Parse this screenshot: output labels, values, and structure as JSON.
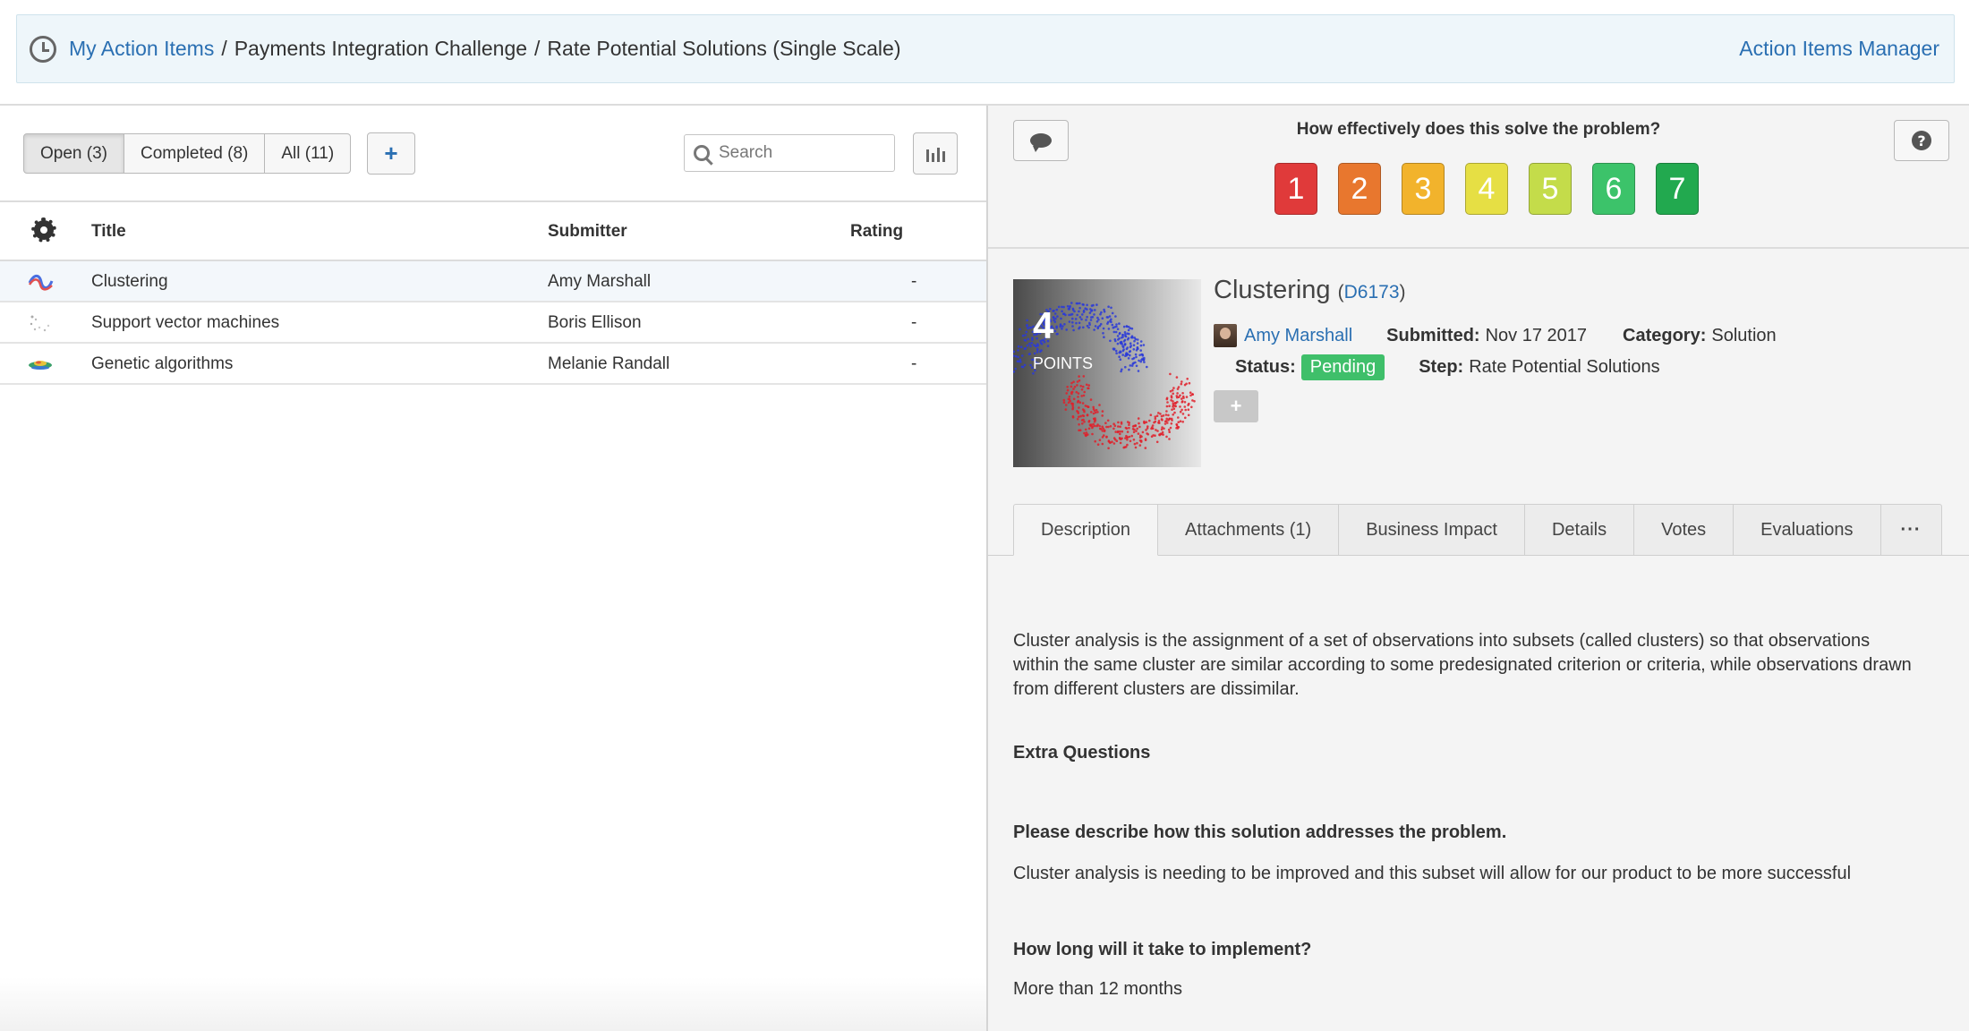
{
  "breadcrumb": {
    "root": "My Action Items",
    "sep": "/",
    "challenge": "Payments Integration Challenge",
    "step": "Rate Potential Solutions (Single Scale)",
    "manager_link": "Action Items Manager"
  },
  "filters": {
    "open": "Open (3)",
    "completed": "Completed (8)",
    "all": "All (11)"
  },
  "add_label": "+",
  "search": {
    "placeholder": "Search",
    "value": ""
  },
  "table": {
    "headers": {
      "title": "Title",
      "submitter": "Submitter",
      "rating": "Rating"
    },
    "rows": [
      {
        "title": "Clustering",
        "submitter": "Amy Marshall",
        "rating": "-"
      },
      {
        "title": "Support vector machines",
        "submitter": "Boris Ellison",
        "rating": "-"
      },
      {
        "title": "Genetic algorithms",
        "submitter": "Melanie Randall",
        "rating": "-"
      }
    ]
  },
  "rating_panel": {
    "question": "How effectively does this solve the problem?",
    "help_glyph": "?",
    "scale": [
      {
        "label": "1",
        "color": "#e03a3a"
      },
      {
        "label": "2",
        "color": "#e8772e"
      },
      {
        "label": "3",
        "color": "#f2b32c"
      },
      {
        "label": "4",
        "color": "#e6df44"
      },
      {
        "label": "5",
        "color": "#c4dc4a"
      },
      {
        "label": "6",
        "color": "#3cc36a"
      },
      {
        "label": "7",
        "color": "#22a94f"
      }
    ]
  },
  "idea": {
    "points": "4",
    "points_label": "POINTS",
    "title": "Clustering",
    "id": "D6173",
    "author": "Amy Marshall",
    "submitted_label": "Submitted:",
    "submitted": "Nov 17 2017",
    "category_label": "Category:",
    "category": "Solution",
    "status_label": "Status:",
    "status": "Pending",
    "status_color": "#3fbf6a",
    "step_label": "Step:",
    "step": "Rate Potential Solutions",
    "tag_button": "+"
  },
  "tabs": {
    "description": "Description",
    "attachments": "Attachments (1)",
    "business_impact": "Business Impact",
    "details": "Details",
    "votes": "Votes",
    "evaluations": "Evaluations",
    "more": "···"
  },
  "description": {
    "body": "Cluster analysis is the assignment of a set of observations into subsets (called clusters) so that observations within the same cluster are similar according to some predesignated criterion or criteria, while observations drawn from different clusters are dissimilar.",
    "extra_heading": "Extra Questions",
    "q1": "Please describe how this solution addresses the problem.",
    "a1": "Cluster analysis is needing to be improved and this subset will allow for our product to be more successful",
    "q2": "How long will it take to implement?",
    "a2": "More than 12 months"
  },
  "colors": {
    "link": "#2a6fb2",
    "breadcrumb_bg": "#eef6fa"
  }
}
